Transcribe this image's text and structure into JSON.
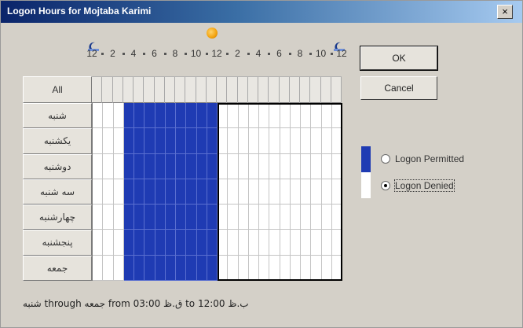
{
  "window": {
    "title": "Logon Hours for Mojtaba Karimi",
    "close_glyph": "×"
  },
  "hour_scale": {
    "labels": [
      "12",
      "2",
      "4",
      "6",
      "8",
      "10",
      "12",
      "2",
      "4",
      "6",
      "8",
      "10",
      "12"
    ]
  },
  "grid": {
    "all_label": "All",
    "days": [
      "شنبه",
      "یکشنبه",
      "دوشنبه",
      "سه شنبه",
      "چهارشنبه",
      "پنجشنبه",
      "جمعه"
    ],
    "hours": 24,
    "permitted_hours": [
      3,
      4,
      5,
      6,
      7,
      8,
      9,
      10,
      11
    ],
    "selection_hours": [
      12,
      23
    ],
    "permit_color": "#1f3bb3"
  },
  "buttons": {
    "ok": "OK",
    "cancel": "Cancel"
  },
  "legend": {
    "permitted_label": "Logon Permitted",
    "denied_label": "Logon Denied",
    "selected": "denied"
  },
  "status": {
    "text": "شنبه through جمعه from 03:00 ق.ظ to 12:00 ب.ظ"
  },
  "icons": {
    "moon": "moon-icon",
    "sun": "sun-icon"
  }
}
